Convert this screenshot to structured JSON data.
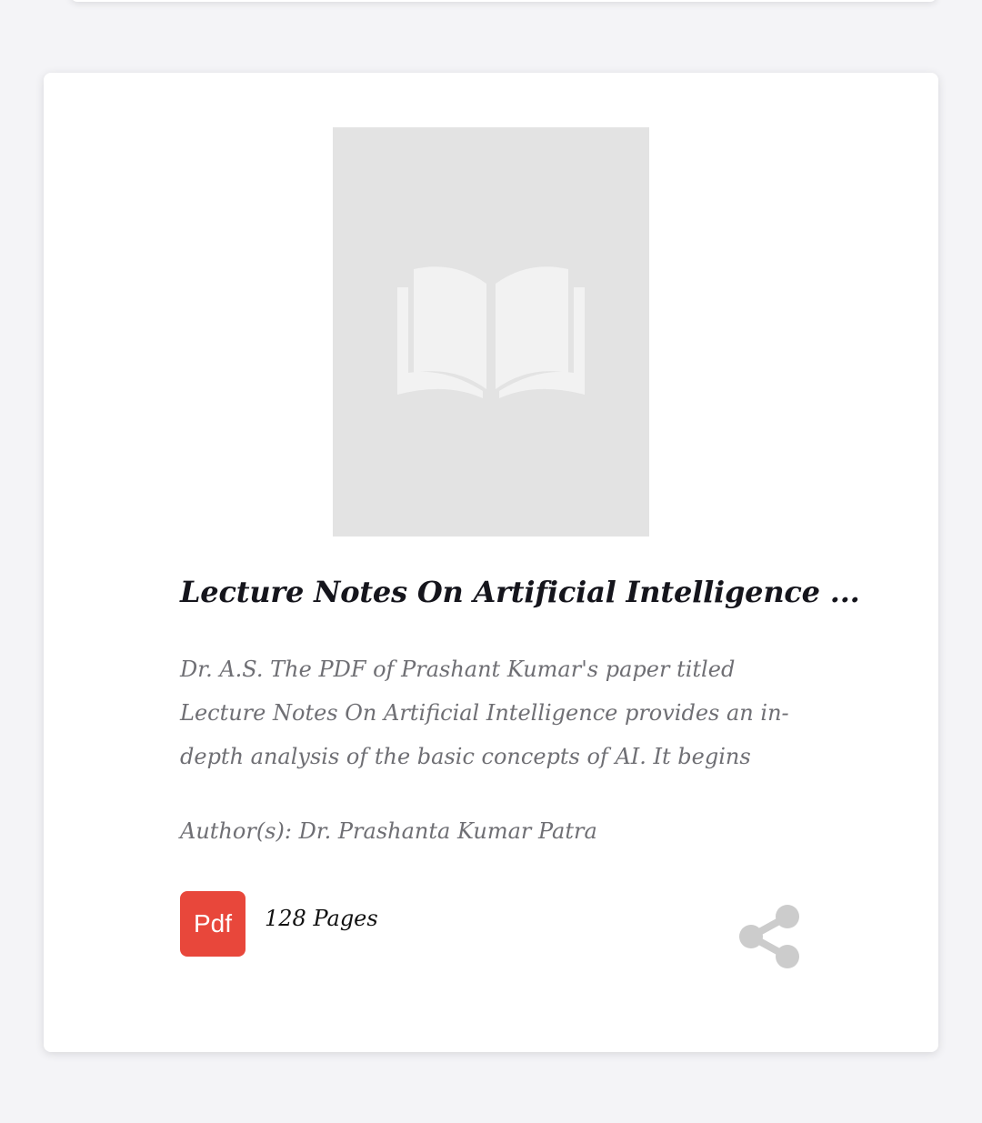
{
  "book": {
    "title": "Lecture Notes On Artificial Intelligence ...",
    "description": "Dr. A.S. The PDF of Prashant Kumar's paper titled Lecture Notes On Artificial Intelligence provides an in-depth analysis of the basic concepts of AI. It begins",
    "author": "Author(s): Dr. Prashanta Kumar Patra",
    "format_label": "Pdf",
    "pages": "128 Pages",
    "cover_icon": "open-book-icon",
    "share_icon": "share-icon"
  },
  "colors": {
    "pdf_badge": "#e8473b",
    "cover_bg": "#e3e3e3",
    "share_icon": "#cccccc"
  }
}
